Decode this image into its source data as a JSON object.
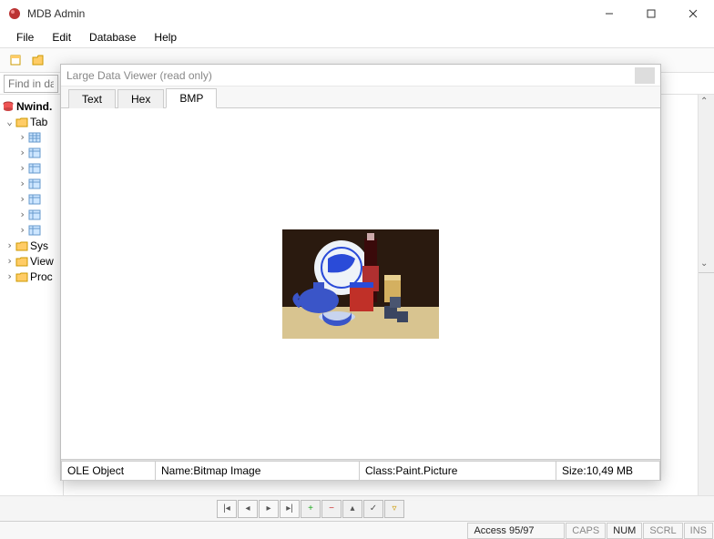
{
  "app": {
    "title": "MDB Admin"
  },
  "menu": {
    "file": "File",
    "edit": "Edit",
    "database": "Database",
    "help": "Help"
  },
  "find": {
    "placeholder": "Find in datal"
  },
  "tree": {
    "root": "Nwind.",
    "tables_group": "Tab",
    "sys": "Sys",
    "views": "View",
    "procs": "Proc"
  },
  "viewer": {
    "title": "Large Data Viewer (read only)",
    "tabs": {
      "text": "Text",
      "hex": "Hex",
      "bmp": "BMP"
    },
    "status": {
      "type": "OLE Object",
      "name_lbl": "Name: ",
      "name_val": "Bitmap Image",
      "class_lbl": "Class: ",
      "class_val": "Paint.Picture",
      "size_lbl": "Size: ",
      "size_val": "10,49 MB"
    }
  },
  "bottom": {
    "engine": "Access 95/97"
  },
  "indicators": {
    "caps": "CAPS",
    "num": "NUM",
    "scrl": "SCRL",
    "ins": "INS"
  }
}
